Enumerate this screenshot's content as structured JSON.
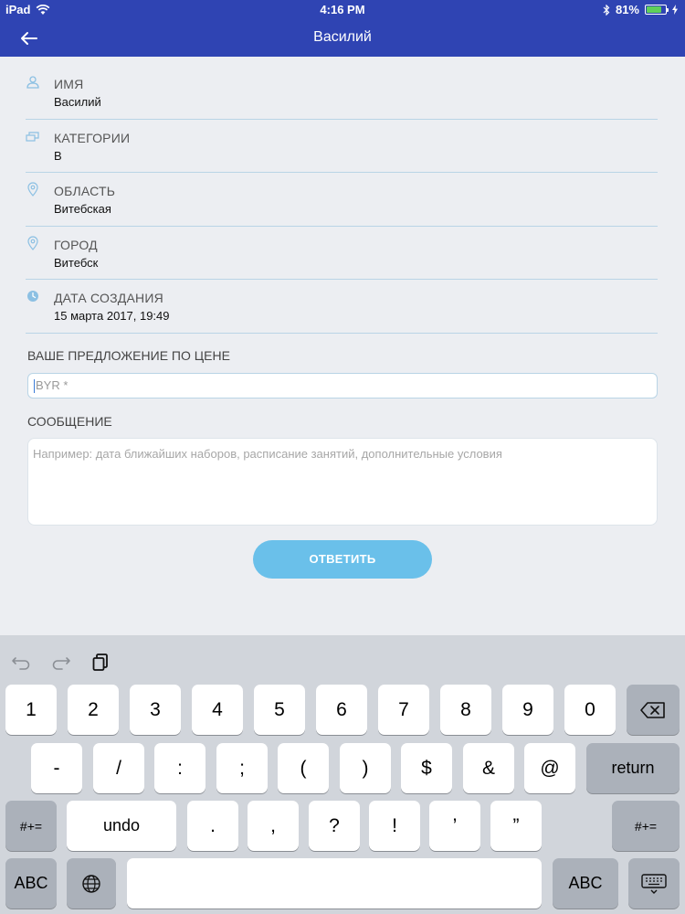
{
  "status": {
    "device": "iPad",
    "time": "4:16 PM",
    "battery": "81%",
    "battery_level": 0.81
  },
  "nav": {
    "title": "Василий"
  },
  "fields": [
    {
      "icon": "person-icon",
      "label": "ИМЯ",
      "value": "Василий"
    },
    {
      "icon": "categories-icon",
      "label": "КАТЕГОРИИ",
      "value": "B"
    },
    {
      "icon": "location-pin-icon",
      "label": "ОБЛАСТЬ",
      "value": "Витебская"
    },
    {
      "icon": "location-pin-icon",
      "label": "ГОРОД",
      "value": "Витебск"
    },
    {
      "icon": "clock-icon",
      "label": "ДАТА СОЗДАНИЯ",
      "value": "15 марта 2017, 19:49"
    }
  ],
  "form": {
    "price_label": "ВАШЕ ПРЕДЛОЖЕНИЕ ПО ЦЕНЕ",
    "price_placeholder": "BYR *",
    "message_label": "СООБЩЕНИЕ",
    "message_placeholder": "Например: дата ближайших наборов, расписание занятий, дополнительные условия",
    "submit_label": "ОТВЕТИТЬ"
  },
  "colors": {
    "header": "#2f44b3",
    "accent_button": "#6ac0ea",
    "divider": "#b9d4e6"
  },
  "keyboard": {
    "row1": [
      "1",
      "2",
      "3",
      "4",
      "5",
      "6",
      "7",
      "8",
      "9",
      "0"
    ],
    "row2": [
      "-",
      "/",
      ":",
      ";",
      "(",
      ")",
      "$",
      "&",
      "@"
    ],
    "return": "return",
    "row3_mod": "#+=",
    "undo": "undo",
    "row3": [
      ".",
      ",",
      "?",
      "!",
      "’",
      "”"
    ],
    "abc": "ABC"
  }
}
